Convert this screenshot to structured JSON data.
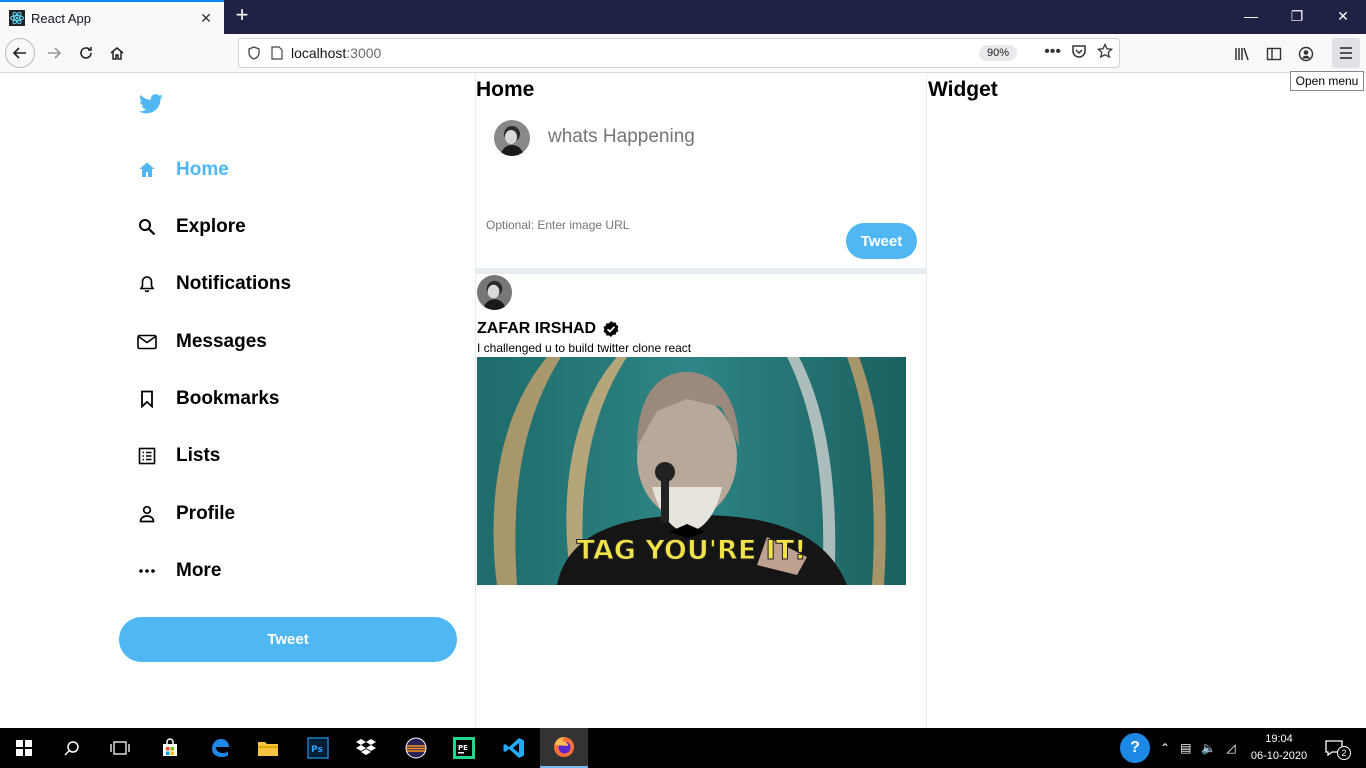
{
  "browser": {
    "tab_title": "React App",
    "tab_close": "✕",
    "new_tab": "+",
    "url_host": "localhost",
    "url_port": ":3000",
    "zoom": "90%",
    "tooltip": "Open menu",
    "window_controls": [
      "—",
      "❐",
      "✕"
    ]
  },
  "sidebar": {
    "items": [
      {
        "label": "Home",
        "icon": "home-icon",
        "active": true
      },
      {
        "label": "Explore",
        "icon": "search-icon"
      },
      {
        "label": "Notifications",
        "icon": "bell-icon"
      },
      {
        "label": "Messages",
        "icon": "mail-icon"
      },
      {
        "label": "Bookmarks",
        "icon": "bookmark-icon"
      },
      {
        "label": "Lists",
        "icon": "list-icon"
      },
      {
        "label": "Profile",
        "icon": "person-icon"
      },
      {
        "label": "More",
        "icon": "more-icon"
      }
    ],
    "tweet_button": "Tweet"
  },
  "feed": {
    "title": "Home",
    "composer": {
      "placeholder": "whats Happening",
      "image_placeholder": "Optional: Enter image URL",
      "button": "Tweet"
    },
    "post": {
      "name": "ZAFAR IRSHAD",
      "text": "I challenged u to build twitter clone react",
      "media_caption": "TAG YOU'RE IT!"
    }
  },
  "widgets": {
    "title": "Widget"
  },
  "taskbar": {
    "time": "19:04",
    "date": "06-10-2020",
    "notifications": "2"
  },
  "colors": {
    "accent": "#50b7f5",
    "titlebar": "#1f2243"
  }
}
